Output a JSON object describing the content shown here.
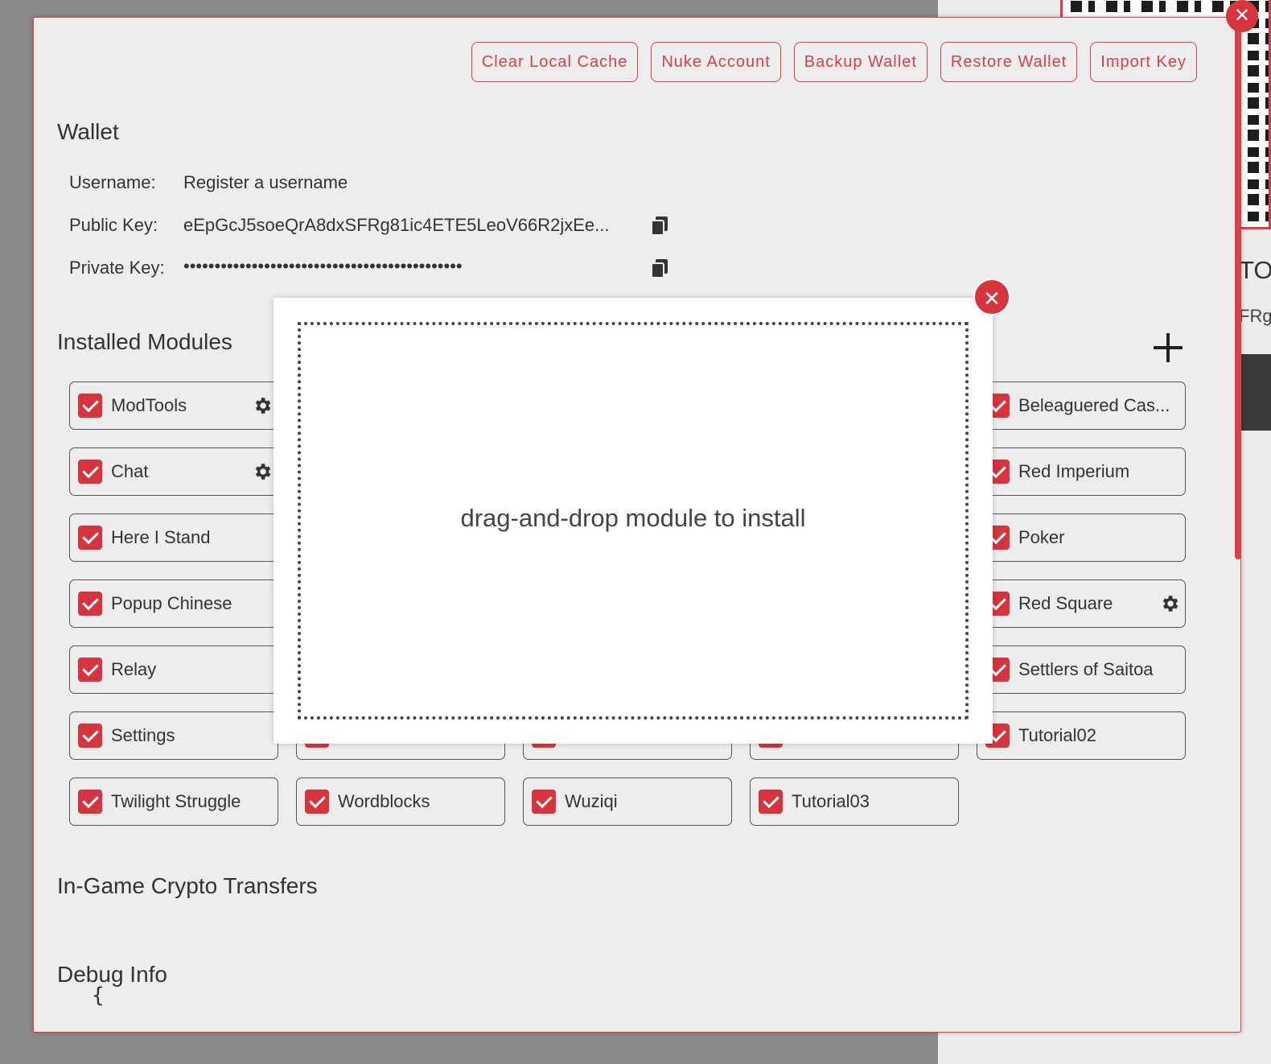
{
  "toolbar": {
    "clear_cache": "Clear Local Cache",
    "nuke_account": "Nuke Account",
    "backup_wallet": "Backup Wallet",
    "restore_wallet": "Restore Wallet",
    "import_key": "Import Key"
  },
  "wallet": {
    "title": "Wallet",
    "username_label": "Username:",
    "username_value": "Register a username",
    "public_key_label": "Public Key:",
    "public_key_value": "eEpGcJ5soeQrA8dxSFRg81ic4ETE5LeoV66R2jxEe...",
    "private_key_label": "Private Key:",
    "private_key_value": "•••••••••••••••••••••••••••••••••••••••••••••"
  },
  "modules": {
    "title": "Installed Modules",
    "items": [
      {
        "label": "ModTools",
        "checked": true,
        "settings": true
      },
      {
        "label": "Chat",
        "checked": true,
        "settings": true
      },
      {
        "label": "Here I Stand",
        "checked": true
      },
      {
        "label": "Popup Chinese",
        "checked": true
      },
      {
        "label": "Relay",
        "checked": true
      },
      {
        "label": "Settings",
        "checked": true
      },
      {
        "label": "Twilight Struggle",
        "checked": true
      },
      {
        "label": "Wordblocks",
        "checked": true
      },
      {
        "label": "Wuziqi",
        "checked": true
      },
      {
        "label": "Tutorial03",
        "checked": true
      },
      {
        "label": "Beleaguered Cas...",
        "checked": true
      },
      {
        "label": "Red Imperium",
        "checked": true
      },
      {
        "label": "Poker",
        "checked": true
      },
      {
        "label": "Red Square",
        "checked": true,
        "settings": true
      },
      {
        "label": "Settlers of Saitoa",
        "checked": true
      },
      {
        "label": "Tutorial02",
        "checked": true
      }
    ]
  },
  "sections": {
    "crypto_transfers": "In-Game Crypto Transfers",
    "debug_info": "Debug Info",
    "debug_start": "{"
  },
  "dialog": {
    "drop_text": "drag-and-drop module to install"
  },
  "background": {
    "text1": "TO",
    "text2": "FRg"
  },
  "colors": {
    "accent": "#d8343e",
    "panel_bg": "#ededed"
  }
}
